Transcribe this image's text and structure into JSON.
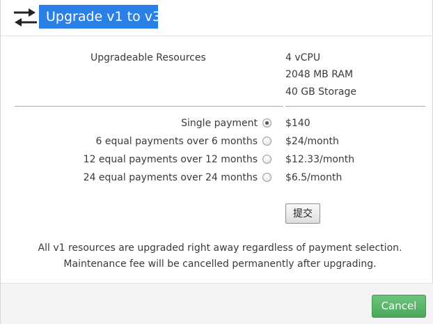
{
  "dialog": {
    "title": "Upgrade v1 to v3",
    "icon": "swap-arrows-icon"
  },
  "resources": {
    "label": "Upgradeable Resources",
    "items": [
      "4 vCPU",
      "2048 MB RAM",
      "40 GB Storage"
    ]
  },
  "payment_options": [
    {
      "label": "Single payment",
      "price": "$140",
      "selected": true
    },
    {
      "label": "6 equal payments over 6 months",
      "price": "$24/month",
      "selected": false
    },
    {
      "label": "12 equal payments over 12 months",
      "price": "$12.33/month",
      "selected": false
    },
    {
      "label": "24 equal payments over 24 months",
      "price": "$6.5/month",
      "selected": false
    }
  ],
  "submit_label": "提交",
  "notes": [
    "All v1 resources are upgraded right away regardless of payment selection.",
    "Maintenance fee will be cancelled permanently after upgrading."
  ],
  "footer": {
    "cancel_label": "Cancel"
  },
  "colors": {
    "title_bg": "#2a80e6",
    "cancel_bg": "#52b062"
  }
}
